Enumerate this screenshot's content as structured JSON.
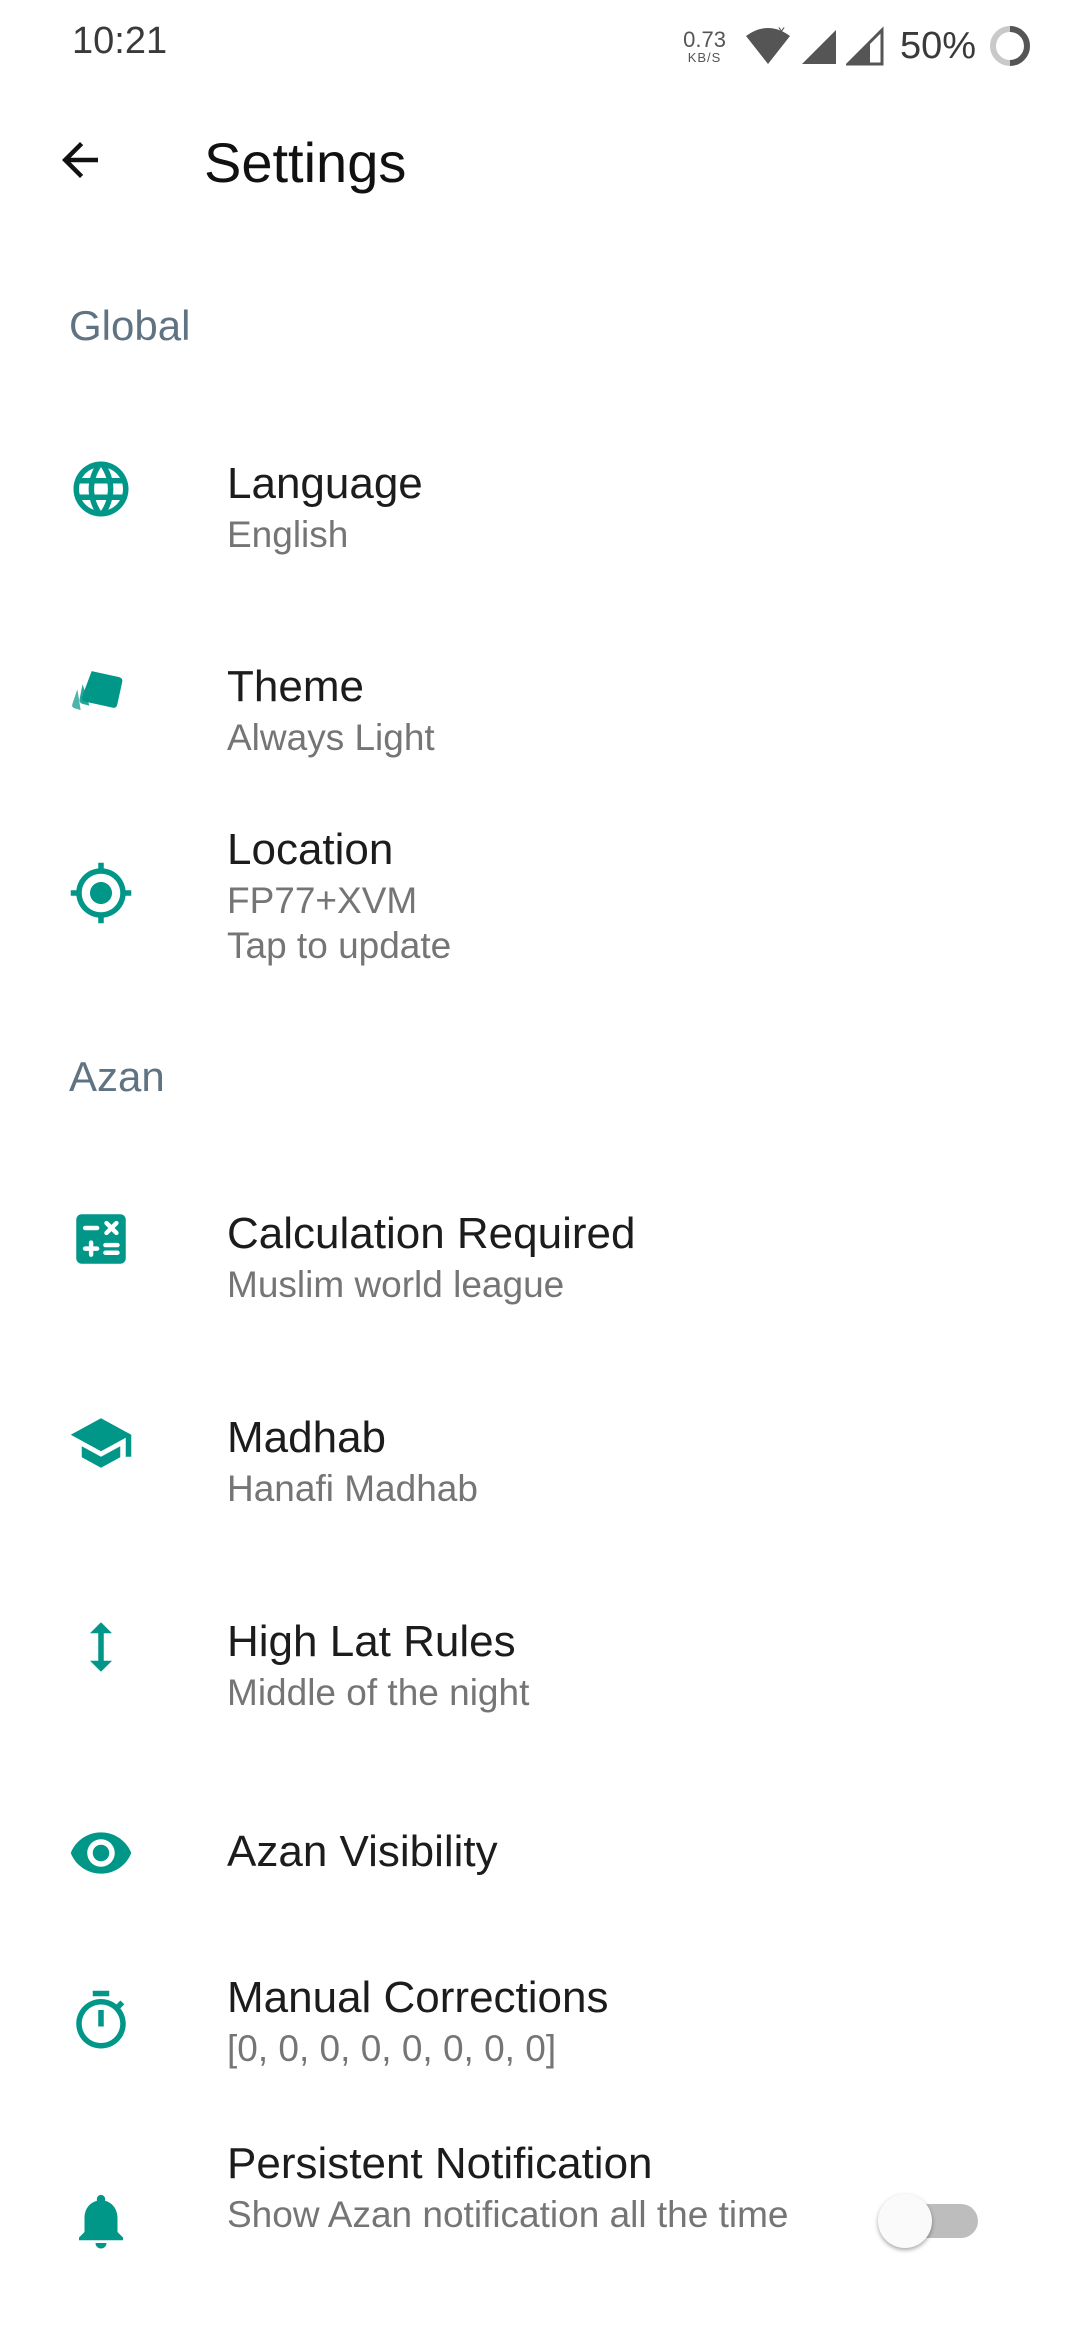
{
  "status_bar": {
    "time": "10:21",
    "speed_value": "0.73",
    "speed_unit": "KB/S",
    "battery": "50%"
  },
  "app_bar": {
    "title": "Settings"
  },
  "colors": {
    "accent": "#009688",
    "section_header": "#5f7383"
  },
  "sections": {
    "global": {
      "header": "Global",
      "items": [
        {
          "icon": "globe-icon",
          "title": "Language",
          "subtitle": "English"
        },
        {
          "icon": "theme-cards-icon",
          "title": "Theme",
          "subtitle": "Always Light"
        },
        {
          "icon": "location-target-icon",
          "title": "Location",
          "subtitle": "FP77+XVM\nTap to update"
        }
      ]
    },
    "azan": {
      "header": "Azan",
      "items": [
        {
          "icon": "calculator-icon",
          "title": "Calculation Required",
          "subtitle": "Muslim world league"
        },
        {
          "icon": "graduation-cap-icon",
          "title": "Madhab",
          "subtitle": "Hanafi Madhab"
        },
        {
          "icon": "vertical-arrows-icon",
          "title": "High Lat Rules",
          "subtitle": "Middle of the night"
        },
        {
          "icon": "eye-icon",
          "title": "Azan Visibility"
        },
        {
          "icon": "timer-icon",
          "title": "Manual Corrections",
          "subtitle": "[0, 0, 0, 0, 0, 0, 0, 0]"
        },
        {
          "icon": "bell-icon",
          "title": "Persistent Notification",
          "subtitle": "Show Azan notification all the time",
          "toggle": false
        }
      ]
    }
  }
}
